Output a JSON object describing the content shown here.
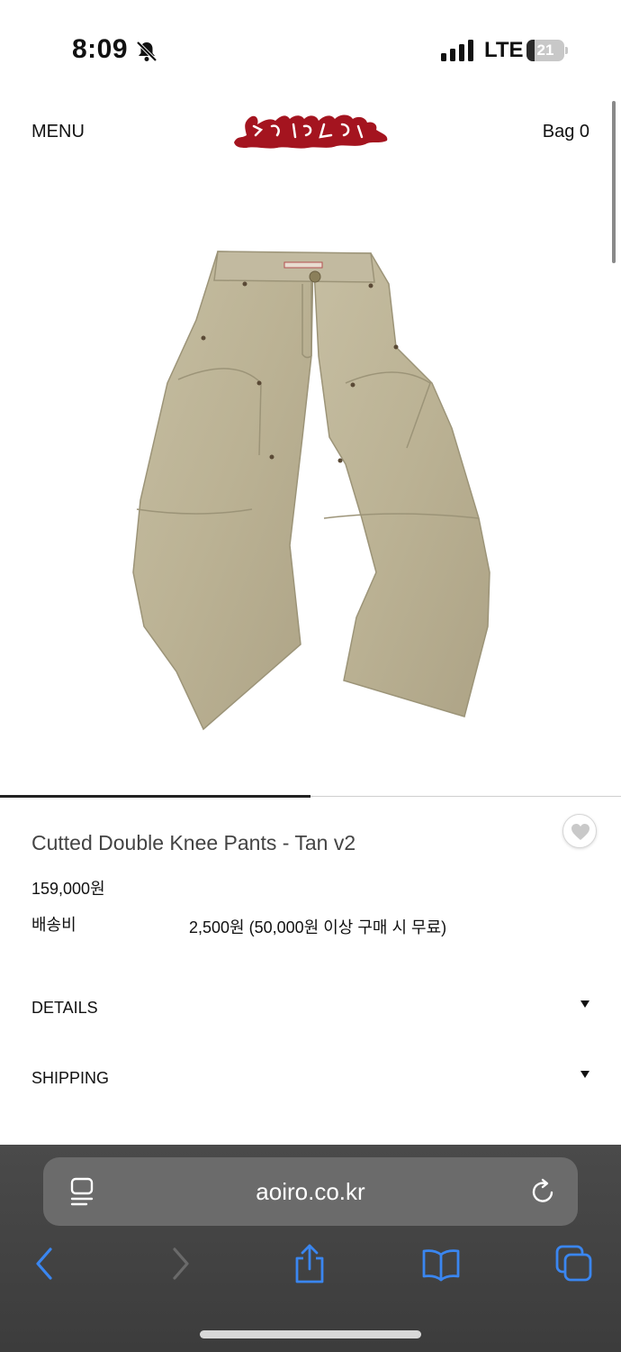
{
  "status_bar": {
    "time": "8:09",
    "network": "LTE",
    "battery": "21",
    "battery_level": 0.21
  },
  "header": {
    "menu": "MENU",
    "logo_text": "aoiro",
    "bag": "Bag 0"
  },
  "product": {
    "image": "tan-double-knee-pants-photo",
    "gallery_progress": 0.5,
    "name": "Cutted Double Knee Pants - Tan v2",
    "price": "159,000원",
    "shipping_label": "배송비",
    "shipping_value": "2,500원 (50,000원 이상 구매 시 무료)"
  },
  "accordions": {
    "details": "DETAILS",
    "shipping": "SHIPPING"
  },
  "browser": {
    "url": "aoiro.co.kr",
    "icons": [
      "reader-icon",
      "reload-icon",
      "back-icon",
      "forward-icon",
      "share-icon",
      "bookmarks-icon",
      "tabs-icon"
    ]
  },
  "colors": {
    "logo": "#a4141f",
    "pants": "#bdb497",
    "toolbar": "#434343",
    "accent_blue": "#3a86f0"
  }
}
